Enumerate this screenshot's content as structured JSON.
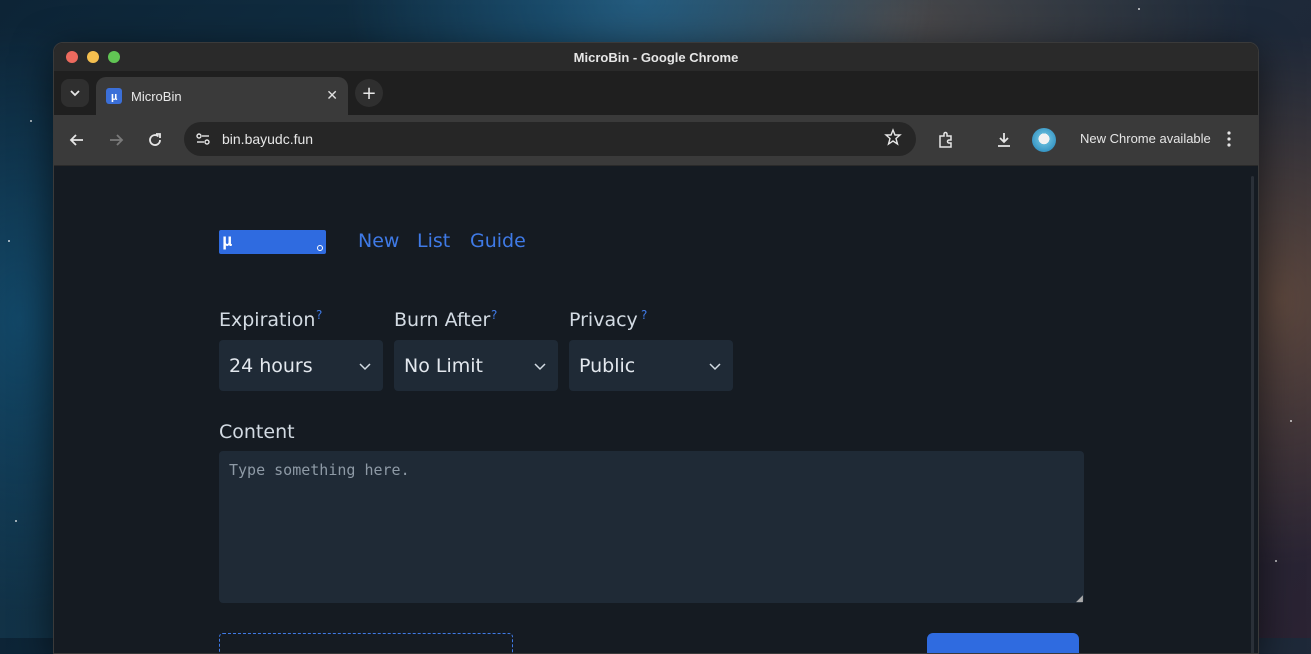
{
  "window": {
    "title": "MicroBin - Google Chrome"
  },
  "tabs": [
    {
      "title": "MicroBin"
    }
  ],
  "toolbar": {
    "url": "bin.bayudc.fun",
    "update_text": "New Chrome available"
  },
  "app": {
    "logo_glyph": "µ",
    "nav": [
      {
        "label": "New"
      },
      {
        "label": "List"
      },
      {
        "label": "Guide"
      }
    ],
    "help_glyph": "?",
    "fields": {
      "expiration": {
        "label": "Expiration",
        "value": "24 hours"
      },
      "burn_after": {
        "label": "Burn After",
        "value": "No Limit"
      },
      "privacy": {
        "label": "Privacy",
        "value": "Public"
      }
    },
    "content": {
      "label": "Content",
      "placeholder": "Type something here."
    }
  },
  "colors": {
    "accent": "#3f7ae6",
    "page_bg": "#151b22",
    "field_bg": "#1f2a36"
  },
  "icons": [
    "tab-search-icon",
    "close-icon",
    "plus-icon",
    "back-icon",
    "forward-icon",
    "reload-icon",
    "site-settings-icon",
    "bookmark-star-icon",
    "extensions-icon",
    "download-icon",
    "kebab-menu-icon",
    "chevron-down-icon"
  ]
}
